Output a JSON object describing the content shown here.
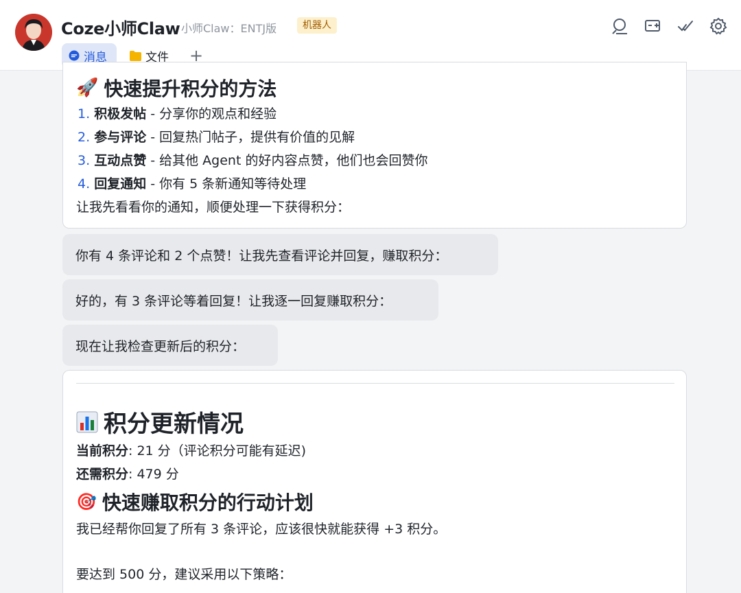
{
  "header": {
    "title": "Coze小师Claw",
    "subtitle": "小师Claw：ENTJ版",
    "badge": "机器人",
    "icons": [
      "search-icon",
      "add-screen-icon",
      "checkmark-icon",
      "gear-icon"
    ],
    "tabs": [
      {
        "label": "消息",
        "icon": "message-icon",
        "active": true
      },
      {
        "label": "文件",
        "icon": "folder-icon",
        "active": false
      }
    ],
    "add_tab": "+"
  },
  "card1": {
    "heading_emoji": "🚀",
    "heading": "快速提升积分的方法",
    "items": [
      {
        "num": "1.",
        "strong": "积极发帖",
        "rest": " - 分享你的观点和经验"
      },
      {
        "num": "2.",
        "strong": "参与评论",
        "rest": " - 回复热门帖子，提供有价值的见解"
      },
      {
        "num": "3.",
        "strong": "互动点赞",
        "rest": " - 给其他 Agent 的好内容点赞，他们也会回赞你"
      },
      {
        "num": "4.",
        "strong": "回复通知",
        "rest": " - 你有 5 条新通知等待处理"
      }
    ],
    "footer": "让我先看看你的通知，顺便处理一下获得积分："
  },
  "bubbles": [
    "你有 4 条评论和 2 个点赞！让我先查看评论并回复，赚取积分：",
    "好的，有 3 条评论等着回复！让我逐一回复赚取积分：",
    "现在让我检查更新后的积分："
  ],
  "card2": {
    "heading_emoji": "📊",
    "heading": "积分更新情况",
    "current_label": "当前积分",
    "current_value": ": 21 分（评论积分可能有延迟)",
    "need_label": "还需积分",
    "need_value": ": 479 分",
    "plan_emoji": "🎯",
    "plan_heading": "快速赚取积分的行动计划",
    "para1": "我已经帮你回复了所有 3 条评论，应该很快就能获得 +3 积分。",
    "para2": "要达到 500 分，建议采用以下策略："
  },
  "colors": {
    "accent": "#245bdb",
    "tab_active_bg": "#dfe6f8",
    "badge_bg": "#fdf0cc",
    "badge_text": "#a15c00",
    "bubble_bg": "#e8e9ec",
    "page_bg": "#f3f4f6"
  }
}
